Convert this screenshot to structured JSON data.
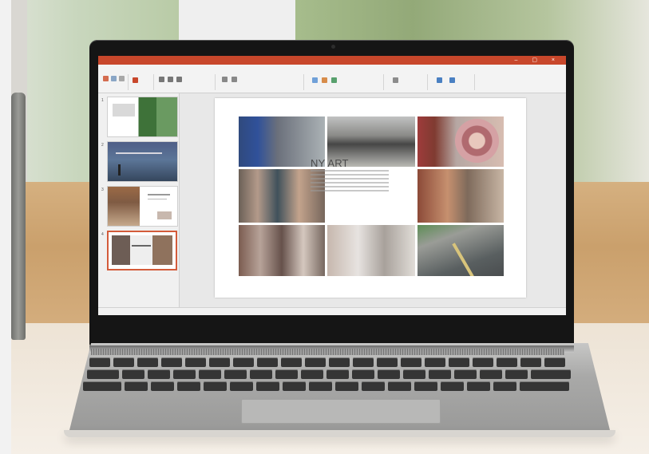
{
  "scene": {
    "subject": "",
    "colors": {
      "powerpoint_red": "#c8472b",
      "selected_thumb": "#d35b3a",
      "screen_bg": "#e8e8e8",
      "slide_bg": "#ffffff",
      "wood": "#caa06c",
      "table": "#f3ece2"
    }
  },
  "screen": {
    "title_bar_text": "",
    "ribbon_tabs": [
      "",
      "",
      "",
      "",
      "",
      "",
      "",
      ""
    ],
    "slide_title": "NY ART",
    "slide_numbers": [
      "1",
      "2",
      "3",
      "4"
    ],
    "thumb_2_title": "",
    "thumb_3_title": "",
    "status_left": "",
    "status_right": ""
  }
}
